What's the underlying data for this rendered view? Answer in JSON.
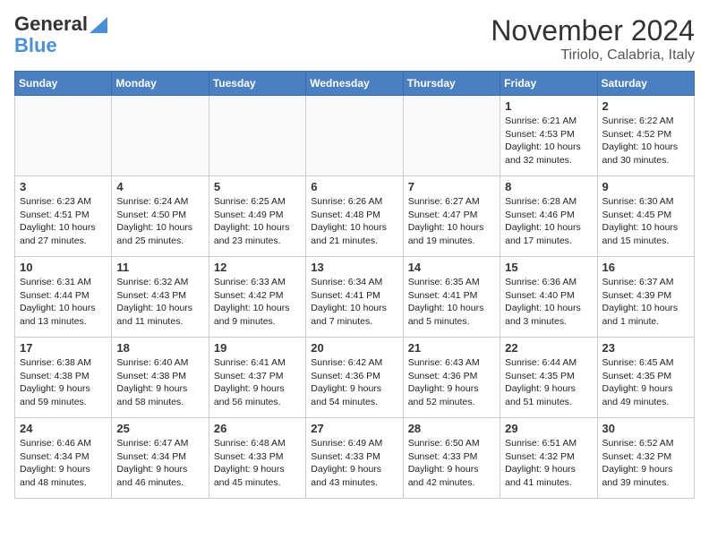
{
  "header": {
    "logo_general": "General",
    "logo_blue": "Blue",
    "month": "November 2024",
    "location": "Tiriolo, Calabria, Italy"
  },
  "weekdays": [
    "Sunday",
    "Monday",
    "Tuesday",
    "Wednesday",
    "Thursday",
    "Friday",
    "Saturday"
  ],
  "weeks": [
    [
      {
        "day": "",
        "info": ""
      },
      {
        "day": "",
        "info": ""
      },
      {
        "day": "",
        "info": ""
      },
      {
        "day": "",
        "info": ""
      },
      {
        "day": "",
        "info": ""
      },
      {
        "day": "1",
        "info": "Sunrise: 6:21 AM\nSunset: 4:53 PM\nDaylight: 10 hours and 32 minutes."
      },
      {
        "day": "2",
        "info": "Sunrise: 6:22 AM\nSunset: 4:52 PM\nDaylight: 10 hours and 30 minutes."
      }
    ],
    [
      {
        "day": "3",
        "info": "Sunrise: 6:23 AM\nSunset: 4:51 PM\nDaylight: 10 hours and 27 minutes."
      },
      {
        "day": "4",
        "info": "Sunrise: 6:24 AM\nSunset: 4:50 PM\nDaylight: 10 hours and 25 minutes."
      },
      {
        "day": "5",
        "info": "Sunrise: 6:25 AM\nSunset: 4:49 PM\nDaylight: 10 hours and 23 minutes."
      },
      {
        "day": "6",
        "info": "Sunrise: 6:26 AM\nSunset: 4:48 PM\nDaylight: 10 hours and 21 minutes."
      },
      {
        "day": "7",
        "info": "Sunrise: 6:27 AM\nSunset: 4:47 PM\nDaylight: 10 hours and 19 minutes."
      },
      {
        "day": "8",
        "info": "Sunrise: 6:28 AM\nSunset: 4:46 PM\nDaylight: 10 hours and 17 minutes."
      },
      {
        "day": "9",
        "info": "Sunrise: 6:30 AM\nSunset: 4:45 PM\nDaylight: 10 hours and 15 minutes."
      }
    ],
    [
      {
        "day": "10",
        "info": "Sunrise: 6:31 AM\nSunset: 4:44 PM\nDaylight: 10 hours and 13 minutes."
      },
      {
        "day": "11",
        "info": "Sunrise: 6:32 AM\nSunset: 4:43 PM\nDaylight: 10 hours and 11 minutes."
      },
      {
        "day": "12",
        "info": "Sunrise: 6:33 AM\nSunset: 4:42 PM\nDaylight: 10 hours and 9 minutes."
      },
      {
        "day": "13",
        "info": "Sunrise: 6:34 AM\nSunset: 4:41 PM\nDaylight: 10 hours and 7 minutes."
      },
      {
        "day": "14",
        "info": "Sunrise: 6:35 AM\nSunset: 4:41 PM\nDaylight: 10 hours and 5 minutes."
      },
      {
        "day": "15",
        "info": "Sunrise: 6:36 AM\nSunset: 4:40 PM\nDaylight: 10 hours and 3 minutes."
      },
      {
        "day": "16",
        "info": "Sunrise: 6:37 AM\nSunset: 4:39 PM\nDaylight: 10 hours and 1 minute."
      }
    ],
    [
      {
        "day": "17",
        "info": "Sunrise: 6:38 AM\nSunset: 4:38 PM\nDaylight: 9 hours and 59 minutes."
      },
      {
        "day": "18",
        "info": "Sunrise: 6:40 AM\nSunset: 4:38 PM\nDaylight: 9 hours and 58 minutes."
      },
      {
        "day": "19",
        "info": "Sunrise: 6:41 AM\nSunset: 4:37 PM\nDaylight: 9 hours and 56 minutes."
      },
      {
        "day": "20",
        "info": "Sunrise: 6:42 AM\nSunset: 4:36 PM\nDaylight: 9 hours and 54 minutes."
      },
      {
        "day": "21",
        "info": "Sunrise: 6:43 AM\nSunset: 4:36 PM\nDaylight: 9 hours and 52 minutes."
      },
      {
        "day": "22",
        "info": "Sunrise: 6:44 AM\nSunset: 4:35 PM\nDaylight: 9 hours and 51 minutes."
      },
      {
        "day": "23",
        "info": "Sunrise: 6:45 AM\nSunset: 4:35 PM\nDaylight: 9 hours and 49 minutes."
      }
    ],
    [
      {
        "day": "24",
        "info": "Sunrise: 6:46 AM\nSunset: 4:34 PM\nDaylight: 9 hours and 48 minutes."
      },
      {
        "day": "25",
        "info": "Sunrise: 6:47 AM\nSunset: 4:34 PM\nDaylight: 9 hours and 46 minutes."
      },
      {
        "day": "26",
        "info": "Sunrise: 6:48 AM\nSunset: 4:33 PM\nDaylight: 9 hours and 45 minutes."
      },
      {
        "day": "27",
        "info": "Sunrise: 6:49 AM\nSunset: 4:33 PM\nDaylight: 9 hours and 43 minutes."
      },
      {
        "day": "28",
        "info": "Sunrise: 6:50 AM\nSunset: 4:33 PM\nDaylight: 9 hours and 42 minutes."
      },
      {
        "day": "29",
        "info": "Sunrise: 6:51 AM\nSunset: 4:32 PM\nDaylight: 9 hours and 41 minutes."
      },
      {
        "day": "30",
        "info": "Sunrise: 6:52 AM\nSunset: 4:32 PM\nDaylight: 9 hours and 39 minutes."
      }
    ]
  ]
}
